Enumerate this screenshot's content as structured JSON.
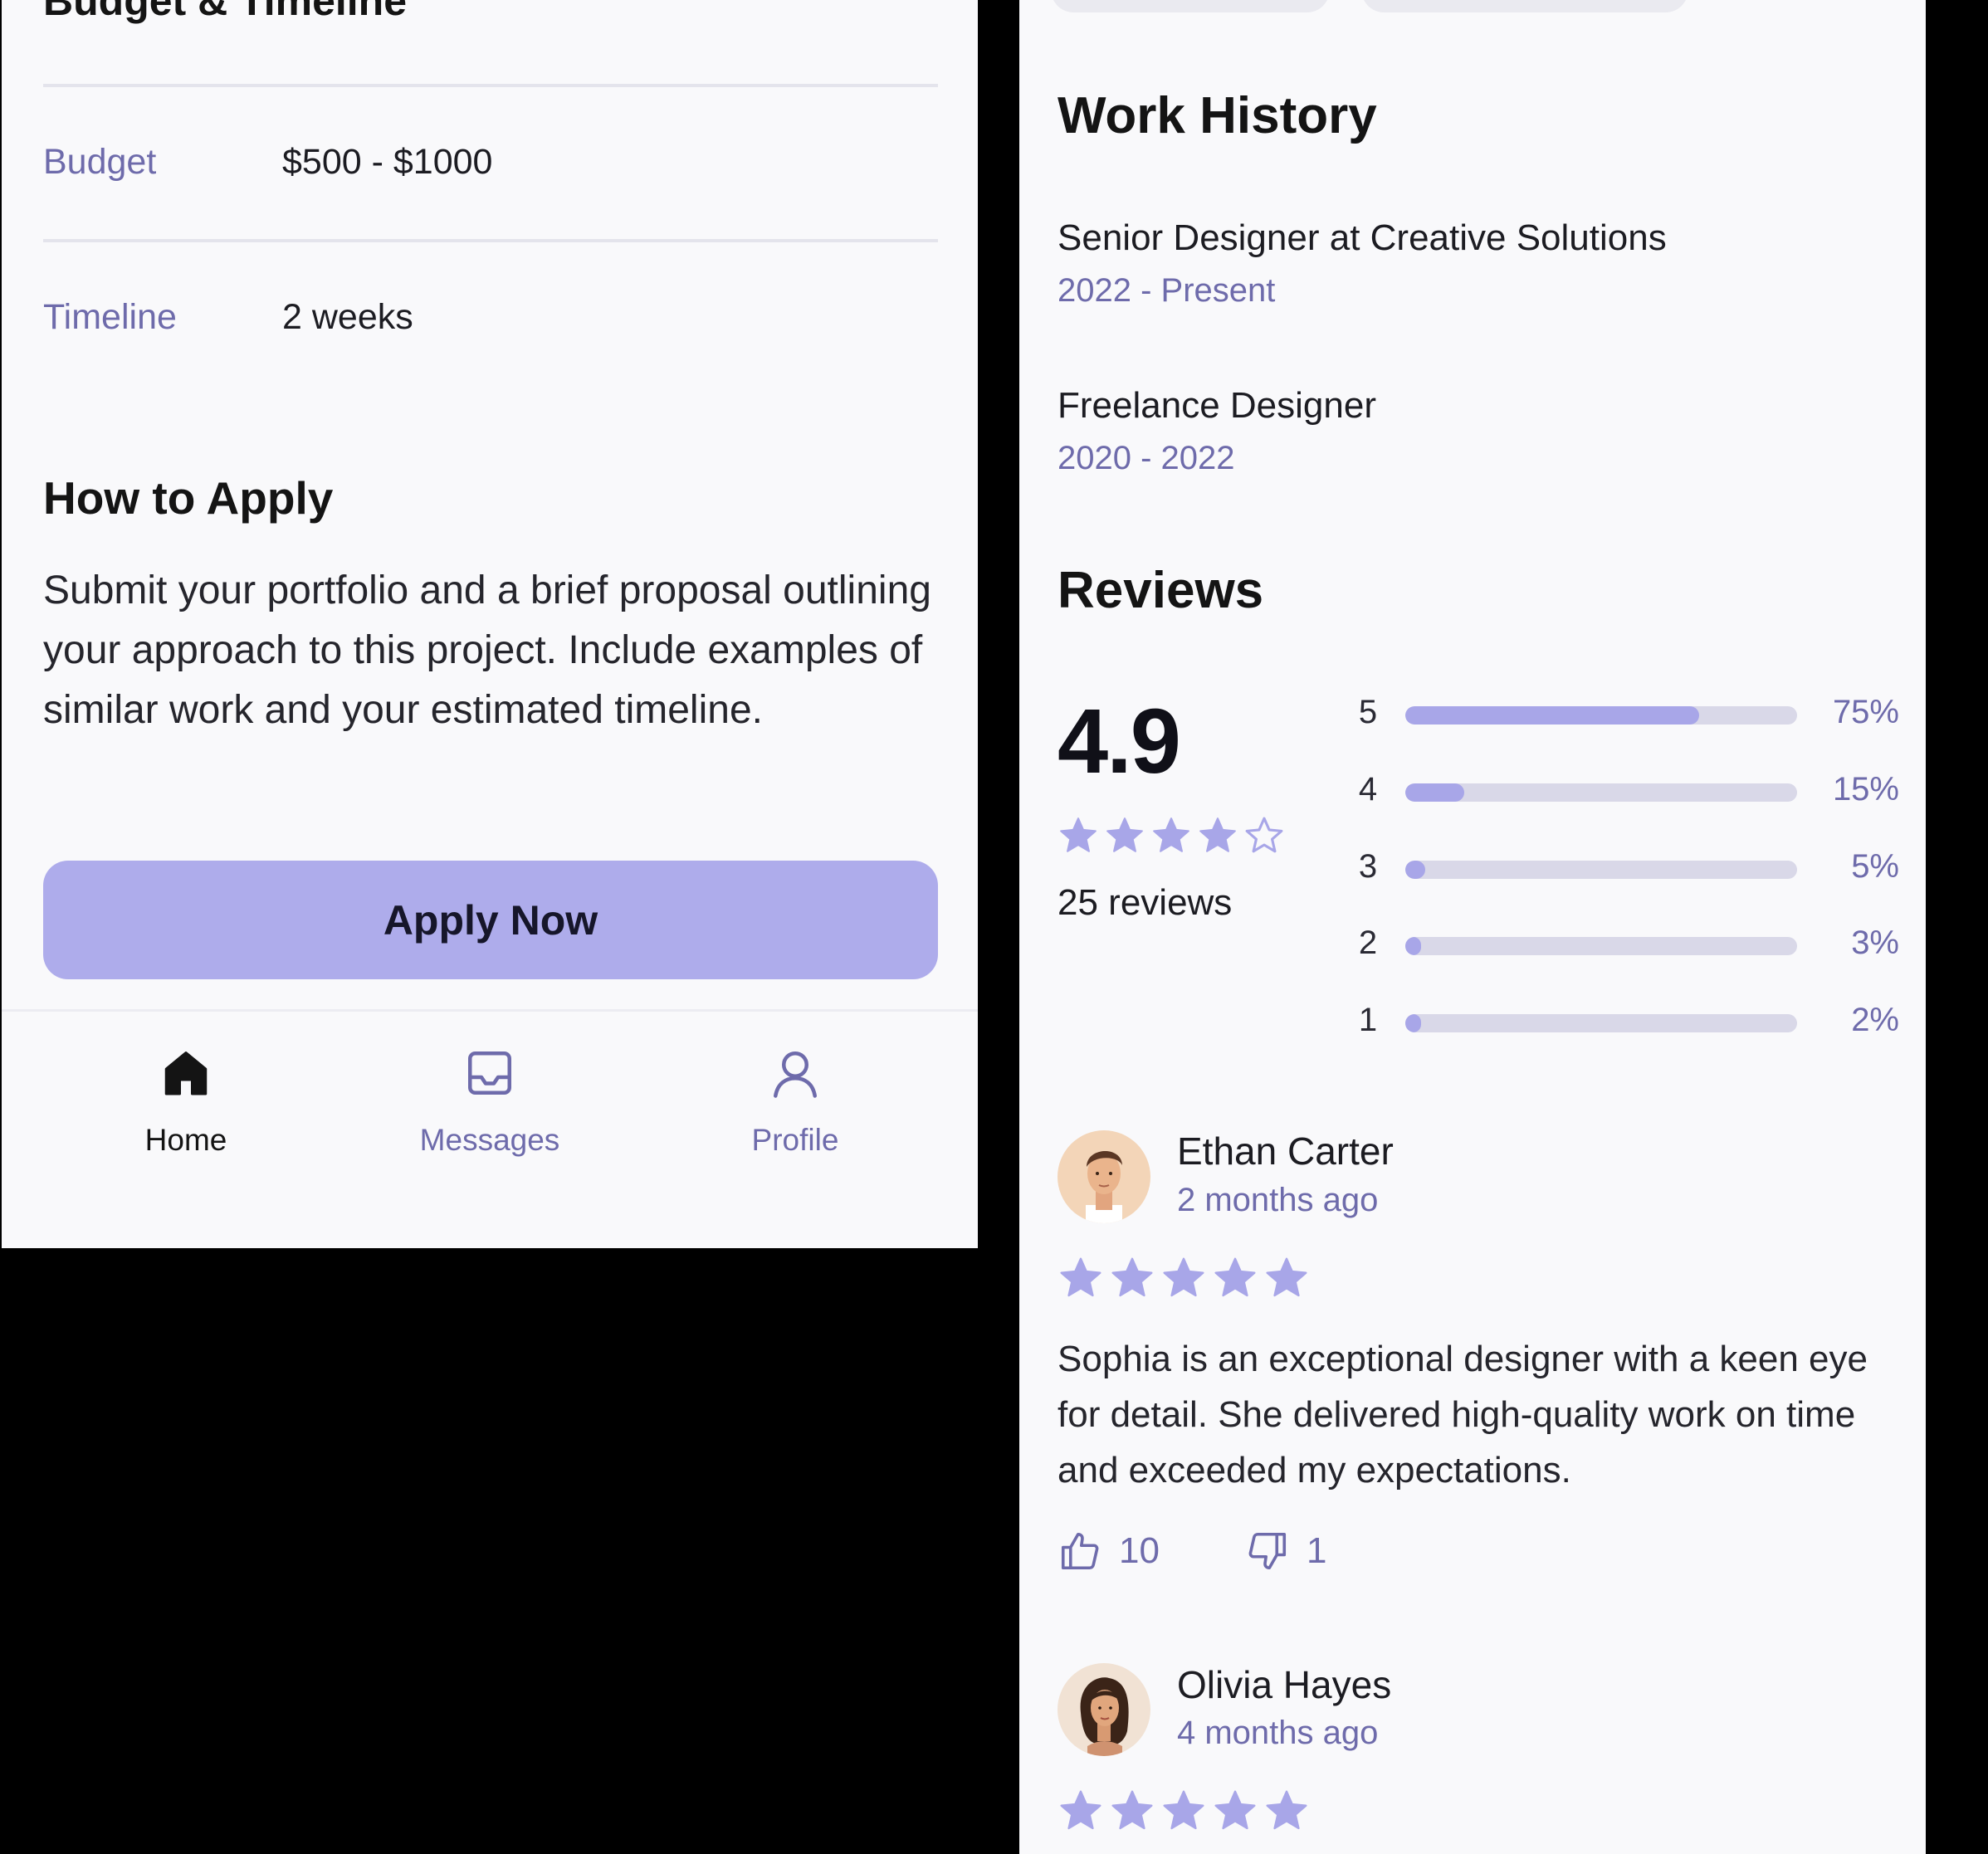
{
  "left": {
    "section_title": "Budget & Timeline",
    "budget_label": "Budget",
    "budget_value": "$500 - $1000",
    "timeline_label": "Timeline",
    "timeline_value": "2 weeks",
    "apply_title": "How to Apply",
    "apply_body": "Submit your portfolio and a brief proposal outlining your approach to this project. Include examples of similar work and your estimated timeline.",
    "apply_button": "Apply Now",
    "nav": {
      "home": "Home",
      "messages": "Messages",
      "profile": "Profile"
    }
  },
  "right": {
    "work_history_title": "Work History",
    "jobs": [
      {
        "title": "Senior Designer at Creative Solutions",
        "dates": "2022 - Present"
      },
      {
        "title": "Freelance Designer",
        "dates": "2020 - 2022"
      }
    ],
    "reviews_title": "Reviews",
    "rating": "4.9",
    "rating_stars": 4,
    "reviews_count": "25 reviews",
    "distribution": [
      {
        "star": "5",
        "percent": "75%",
        "fraction": 0.75
      },
      {
        "star": "4",
        "percent": "15%",
        "fraction": 0.15
      },
      {
        "star": "3",
        "percent": "5%",
        "fraction": 0.05
      },
      {
        "star": "2",
        "percent": "3%",
        "fraction": 0.03
      },
      {
        "star": "1",
        "percent": "2%",
        "fraction": 0.02
      }
    ],
    "reviews": [
      {
        "name": "Ethan Carter",
        "time": "2 months ago",
        "stars": 5,
        "text": "Sophia is an exceptional designer with a keen eye for detail. She delivered high-quality work on time and exceeded my expectations.",
        "likes": "10",
        "dislikes": "1"
      },
      {
        "name": "Olivia Hayes",
        "time": "4 months ago",
        "stars": 5
      }
    ]
  },
  "colors": {
    "accent": "#aeaceb",
    "accent_text": "#6e6bab",
    "bar_fill": "#a8a6e8",
    "bar_track": "#d9d8e8",
    "panel_bg": "#f9f9fb"
  },
  "icons": {
    "home": "home-icon",
    "messages": "inbox-icon",
    "profile": "user-icon",
    "like": "thumbs-up-icon",
    "dislike": "thumbs-down-icon",
    "star": "star-icon"
  }
}
